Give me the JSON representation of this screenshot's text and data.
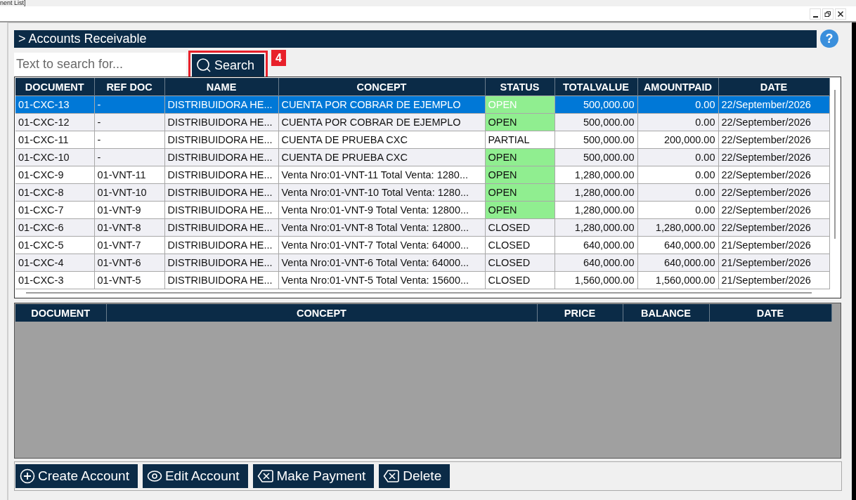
{
  "window": {
    "title": "nent List]"
  },
  "header": {
    "title": "> Accounts Receivable",
    "help": "?"
  },
  "search": {
    "placeholder": "Text to search for...",
    "button": "Search",
    "annotation": "4"
  },
  "accounts": {
    "columns": [
      "DOCUMENT",
      "REF DOC",
      "NAME",
      "CONCEPT",
      "STATUS",
      "TOTALVALUE",
      "AMOUNTPAID",
      "DATE"
    ],
    "rows": [
      {
        "cells": [
          "01-CXC-13",
          "-",
          "DISTRIBUIDORA HE...",
          "CUENTA POR COBRAR DE EJEMPLO",
          "OPEN",
          "500,000.00",
          "0.00",
          "22/September/2026"
        ],
        "selected": true,
        "status_highlight": true
      },
      {
        "cells": [
          "01-CXC-12",
          "-",
          "DISTRIBUIDORA HE...",
          "CUENTA POR COBRAR DE EJEMPLO",
          "OPEN",
          "500,000.00",
          "0.00",
          "22/September/2026"
        ],
        "selected": false,
        "status_highlight": true
      },
      {
        "cells": [
          "01-CXC-11",
          "-",
          "DISTRIBUIDORA HE...",
          "CUENTA DE PRUEBA CXC",
          "PARTIAL",
          "500,000.00",
          "200,000.00",
          "22/September/2026"
        ],
        "selected": false,
        "status_highlight": false
      },
      {
        "cells": [
          "01-CXC-10",
          "-",
          "DISTRIBUIDORA HE...",
          "CUENTA DE PRUEBA CXC",
          "OPEN",
          "500,000.00",
          "0.00",
          "22/September/2026"
        ],
        "selected": false,
        "status_highlight": true
      },
      {
        "cells": [
          "01-CXC-9",
          "01-VNT-11",
          "DISTRIBUIDORA HE...",
          "Venta Nro:01-VNT-11 Total Venta: 1280...",
          "OPEN",
          "1,280,000.00",
          "0.00",
          "22/September/2026"
        ],
        "selected": false,
        "status_highlight": true
      },
      {
        "cells": [
          "01-CXC-8",
          "01-VNT-10",
          "DISTRIBUIDORA HE...",
          "Venta Nro:01-VNT-10 Total Venta: 1280...",
          "OPEN",
          "1,280,000.00",
          "0.00",
          "22/September/2026"
        ],
        "selected": false,
        "status_highlight": true
      },
      {
        "cells": [
          "01-CXC-7",
          "01-VNT-9",
          "DISTRIBUIDORA HE...",
          "Venta Nro:01-VNT-9 Total Venta: 12800...",
          "OPEN",
          "1,280,000.00",
          "0.00",
          "22/September/2026"
        ],
        "selected": false,
        "status_highlight": true
      },
      {
        "cells": [
          "01-CXC-6",
          "01-VNT-8",
          "DISTRIBUIDORA HE...",
          "Venta Nro:01-VNT-8 Total Venta: 12800...",
          "CLOSED",
          "1,280,000.00",
          "1,280,000.00",
          "22/September/2026"
        ],
        "selected": false,
        "status_highlight": false
      },
      {
        "cells": [
          "01-CXC-5",
          "01-VNT-7",
          "DISTRIBUIDORA HE...",
          "Venta Nro:01-VNT-7 Total Venta: 64000...",
          "CLOSED",
          "640,000.00",
          "640,000.00",
          "21/September/2026"
        ],
        "selected": false,
        "status_highlight": false
      },
      {
        "cells": [
          "01-CXC-4",
          "01-VNT-6",
          "DISTRIBUIDORA HE...",
          "Venta Nro:01-VNT-6 Total Venta: 64000...",
          "CLOSED",
          "640,000.00",
          "640,000.00",
          "21/September/2026"
        ],
        "selected": false,
        "status_highlight": false
      },
      {
        "cells": [
          "01-CXC-3",
          "01-VNT-5",
          "DISTRIBUIDORA HE...",
          "Venta Nro:01-VNT-5 Total Venta: 15600...",
          "CLOSED",
          "1,560,000.00",
          "1,560,000.00",
          "21/September/2026"
        ],
        "selected": false,
        "status_highlight": false
      }
    ]
  },
  "details": {
    "columns": [
      "DOCUMENT",
      "CONCEPT",
      "PRICE",
      "BALANCE",
      "DATE"
    ]
  },
  "actions": [
    {
      "label": "Create Account",
      "kind": "add"
    },
    {
      "label": "Edit Account",
      "kind": "view"
    },
    {
      "label": "Make Payment",
      "kind": "remove"
    },
    {
      "label": "Delete",
      "kind": "remove"
    }
  ]
}
